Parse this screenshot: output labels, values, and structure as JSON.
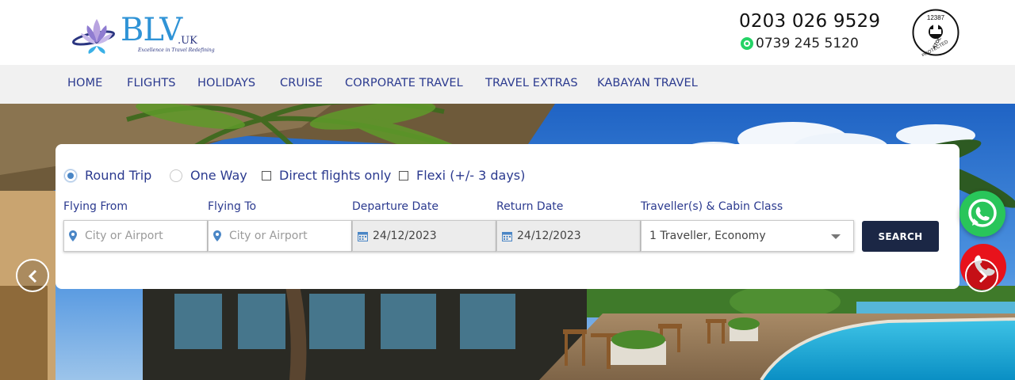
{
  "header": {
    "logo_main": "BLV",
    "logo_suffix": ".UK",
    "logo_tagline": "Excellence in Travel Redefining",
    "phone": "0203 026 9529",
    "whatsapp_phone": "0739 245 5120",
    "atol_number": "12387",
    "atol_label": "ATOL",
    "atol_protected": "PROTECTED"
  },
  "nav": {
    "items": [
      {
        "label": "HOME"
      },
      {
        "label": "FLIGHTS"
      },
      {
        "label": "HOLIDAYS"
      },
      {
        "label": "CRUISE"
      },
      {
        "label": "CORPORATE TRAVEL"
      },
      {
        "label": "TRAVEL EXTRAS"
      },
      {
        "label": "KABAYAN TRAVEL"
      }
    ]
  },
  "search": {
    "trip_types": [
      {
        "label": "Round Trip",
        "selected": true
      },
      {
        "label": "One Way",
        "selected": false
      }
    ],
    "options": [
      {
        "label": "Direct flights only",
        "checked": false
      },
      {
        "label": "Flexi (+/- 3 days)",
        "checked": false
      }
    ],
    "flying_from": {
      "label": "Flying From",
      "placeholder": "City or Airport"
    },
    "flying_to": {
      "label": "Flying To",
      "placeholder": "City or Airport"
    },
    "departure": {
      "label": "Departure Date",
      "value": "24/12/2023"
    },
    "return": {
      "label": "Return Date",
      "value": "24/12/2023"
    },
    "travellers": {
      "label": "Traveller(s) & Cabin Class",
      "value": "1 Traveller, Economy"
    },
    "search_button": "SEARCH"
  },
  "colors": {
    "brand_blue": "#2b3a8f",
    "button_navy": "#1b2745",
    "whatsapp_green": "#29c55a",
    "call_red": "#e8121b"
  }
}
